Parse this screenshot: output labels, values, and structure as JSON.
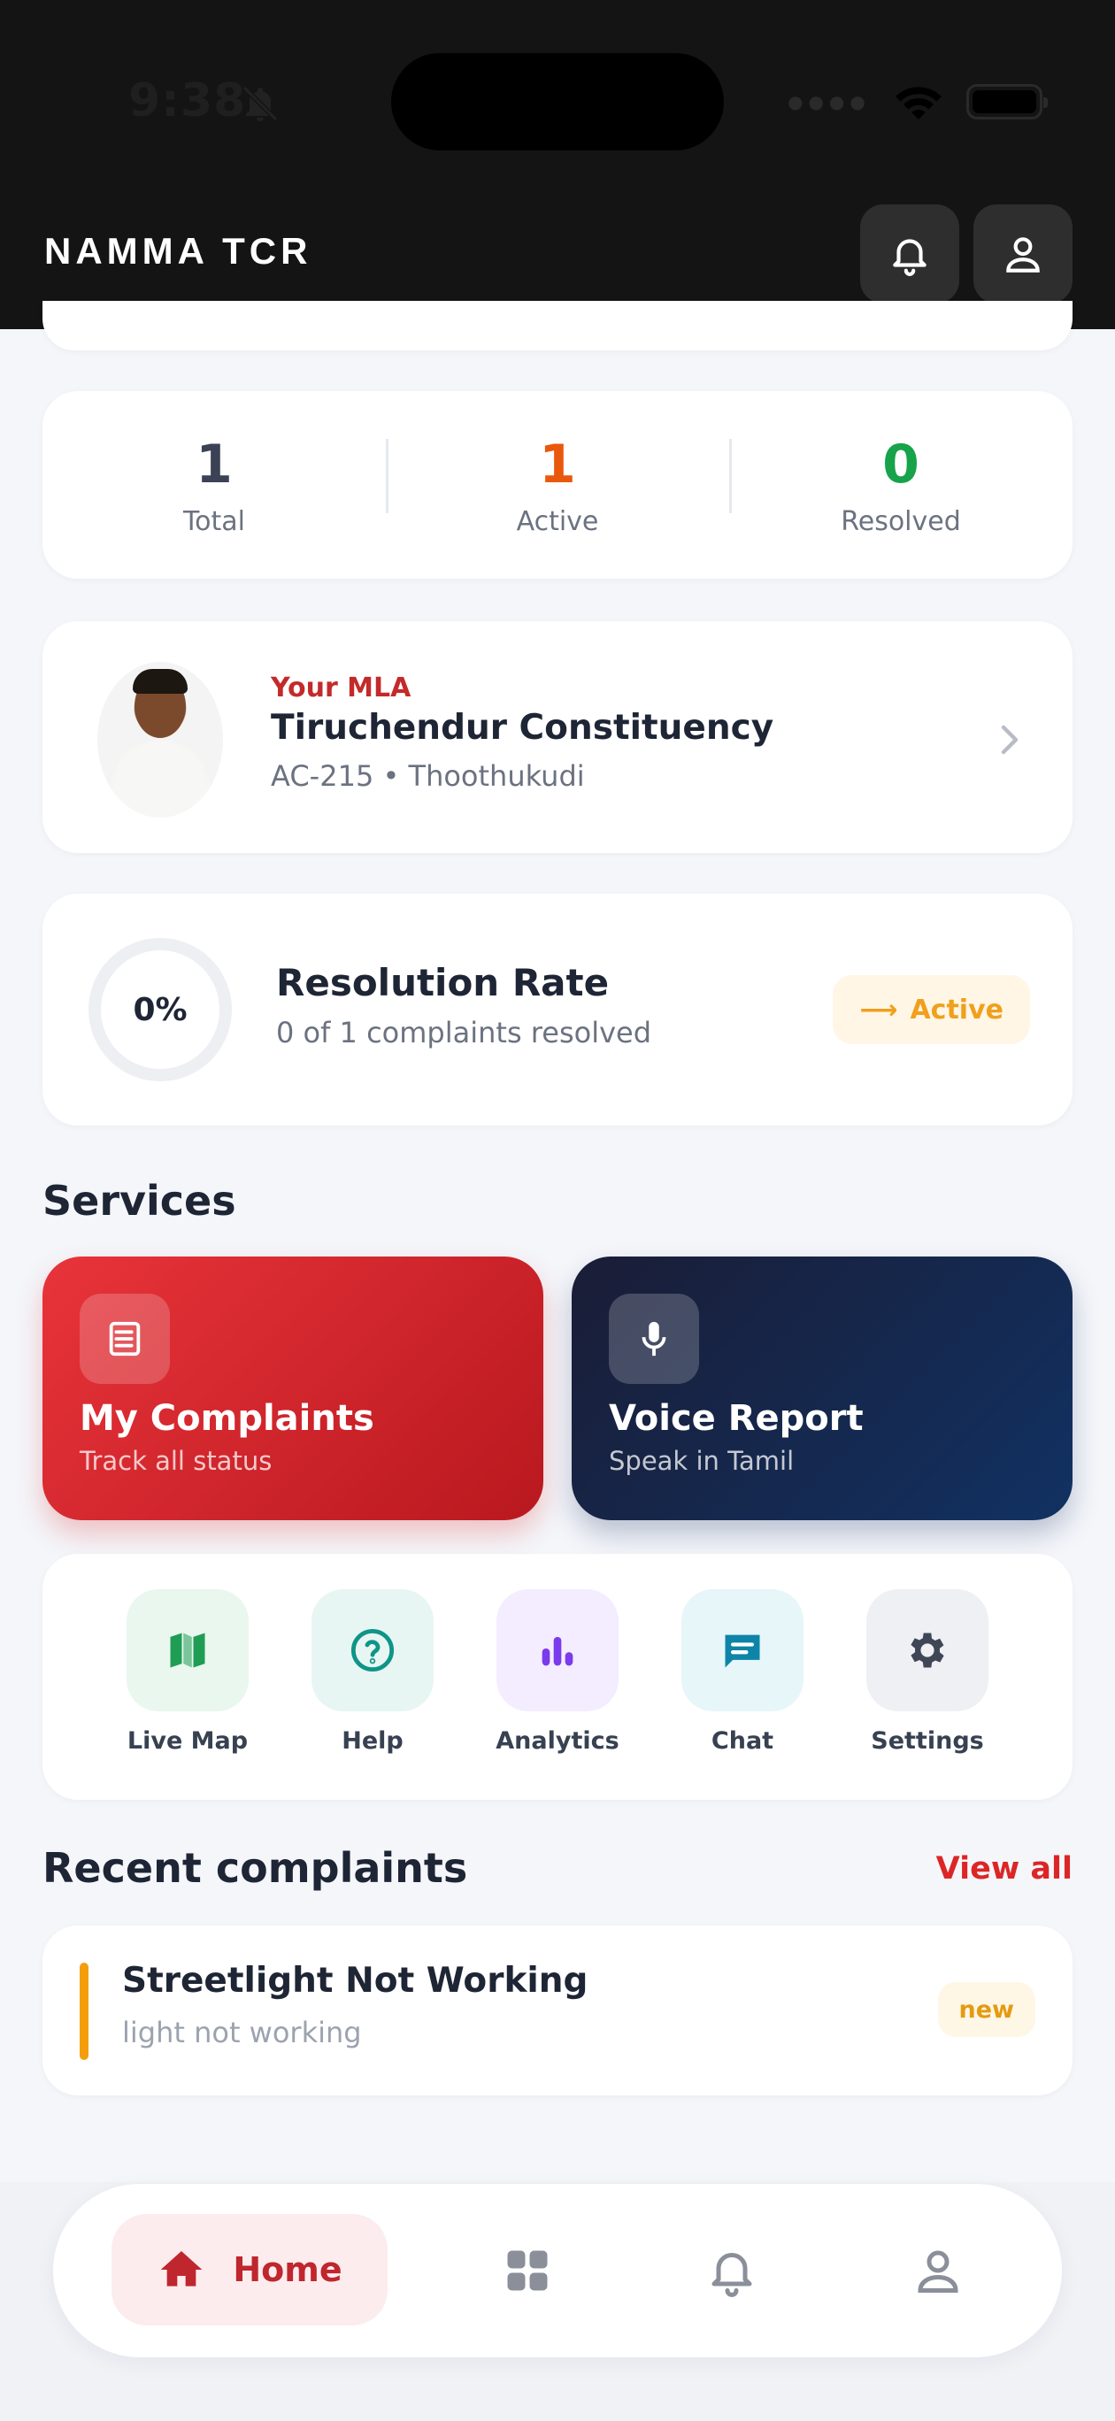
{
  "status_bar": {
    "time": "9:38"
  },
  "header": {
    "title": "NAMMA TCR"
  },
  "stats": [
    {
      "value": "1",
      "label": "Total",
      "color": "#3b4255"
    },
    {
      "value": "1",
      "label": "Active",
      "color": "#ea580c"
    },
    {
      "value": "0",
      "label": "Resolved",
      "color": "#16a34a"
    }
  ],
  "mla": {
    "tag": "Your MLA",
    "name": "Tiruchendur Constituency",
    "detail": "AC-215 • Thoothukudi"
  },
  "resolution": {
    "percent_label": "0%",
    "percent": 0,
    "title": "Resolution Rate",
    "subtitle": "0 of 1 complaints resolved",
    "badge_arrow": "⟶",
    "badge": "Active"
  },
  "services": {
    "title": "Services",
    "tiles": [
      {
        "title": "My Complaints",
        "subtitle": "Track all status"
      },
      {
        "title": "Voice Report",
        "subtitle": "Speak in Tamil"
      }
    ],
    "quick_actions": [
      {
        "label": "Live Map",
        "icon": "map-icon"
      },
      {
        "label": "Help",
        "icon": "help-icon"
      },
      {
        "label": "Analytics",
        "icon": "analytics-icon"
      },
      {
        "label": "Chat",
        "icon": "chat-icon"
      },
      {
        "label": "Settings",
        "icon": "gear-icon"
      }
    ]
  },
  "recent": {
    "title": "Recent complaints",
    "view_all": "View all",
    "items": [
      {
        "title": "Streetlight Not Working",
        "description": "light not working",
        "status": "new"
      }
    ]
  },
  "bottom_nav": {
    "home_label": "Home"
  },
  "colors": {
    "accent": "#dc2626",
    "navy": "#122a55",
    "warning": "#f59e0b"
  }
}
